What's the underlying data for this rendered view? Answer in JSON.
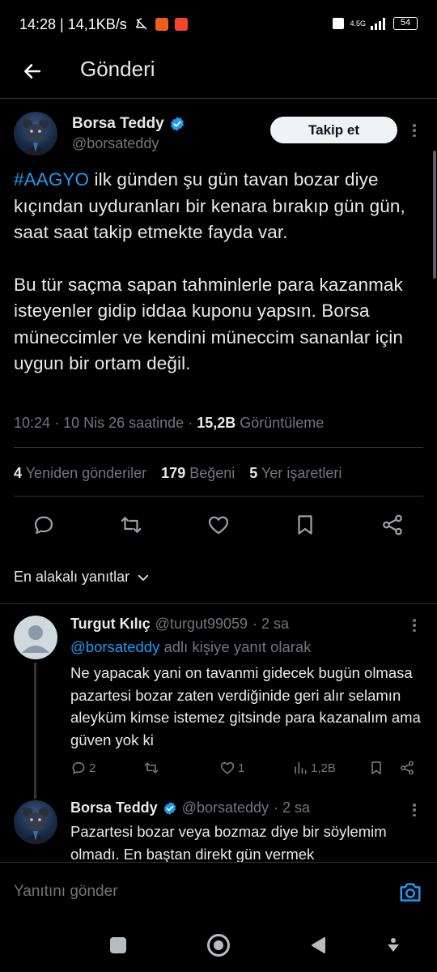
{
  "status_bar": {
    "time_net": "14:28 | 14,1KB/s",
    "network": "4.5G",
    "battery": "54"
  },
  "header": {
    "title": "Gönderi"
  },
  "tweet": {
    "author_name": "Borsa Teddy",
    "author_handle": "@borsateddy",
    "follow_label": "Takip et",
    "hashtag": "#AAGYO",
    "paragraph1_rest": " ilk günden şu gün tavan bozar diye kıçından uyduranları bir kenara bırakıp gün gün, saat saat takip etmekte fayda var.",
    "paragraph2": "Bu tür saçma sapan tahminlerle para kazanmak isteyenler gidip iddaa kuponu yapsın. Borsa müneccimler ve kendini müneccim sananlar için uygun bir ortam değil.",
    "time": "10:24",
    "date": "10 Nis 26 saatinde",
    "views_count": "15,2B",
    "views_label": "Görüntüleme",
    "reposts_count": "4",
    "reposts_label": "Yeniden gönderiler",
    "likes_count": "179",
    "likes_label": "Beğeni",
    "bookmarks_count": "5",
    "bookmarks_label": "Yer işaretleri"
  },
  "sort_label": "En alakalı yanıtlar",
  "replies": [
    {
      "name": "Turgut Kılıç",
      "handle": "@turgut99059",
      "age": "· 2 sa",
      "reply_to_handle": "@borsateddy",
      "reply_to_text": "adlı kişiye yanıt olarak",
      "text": "Ne yapacak yani on tavanmi gidecek bugün olmasa pazartesi bozar zaten verdiğinide geri alır selamın aleyküm kimse istemez gitsinde para kazanalım ama güven yok ki",
      "comments": "2",
      "likes": "1",
      "views": "1,2B"
    },
    {
      "name": "Borsa Teddy",
      "handle": "@borsateddy",
      "age": "· 2 sa",
      "text": "Pazartesi bozar veya bozmaz diye bir söylemim olmadı. En baştan direkt gün vermek"
    }
  ],
  "composer": {
    "placeholder": "Yanıtını gönder"
  },
  "colors": {
    "accent": "#1d9bf0",
    "background": "#000000",
    "text": "#e7e9ea",
    "muted": "#71767b",
    "border": "#2f3336"
  },
  "icons": [
    "back-arrow-icon",
    "verified-badge-icon",
    "more-icon",
    "reply-icon",
    "repost-icon",
    "like-icon",
    "bookmark-icon",
    "share-icon",
    "chevron-down-icon",
    "camera-icon",
    "views-icon"
  ]
}
